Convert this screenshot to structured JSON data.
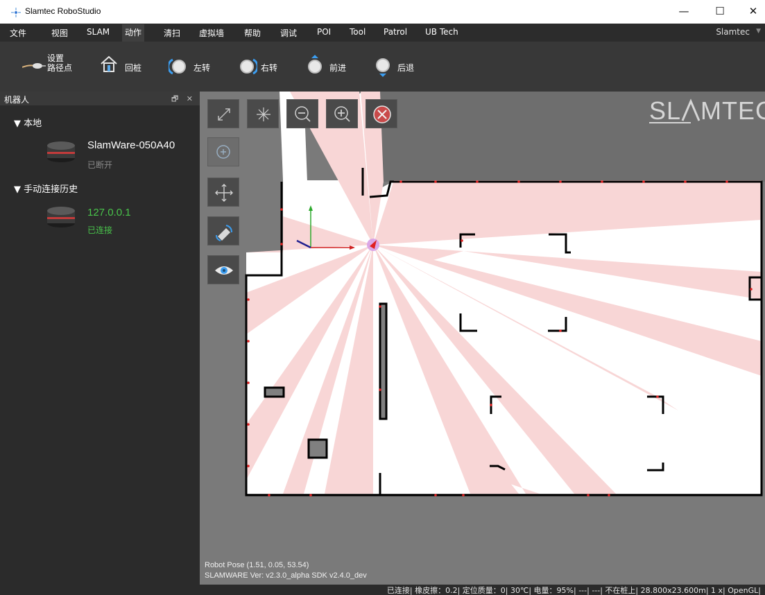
{
  "window": {
    "title": "Slamtec RoboStudio",
    "minimize": "—",
    "maximize": "☐",
    "close": "✕"
  },
  "menu": {
    "items": [
      "文件",
      "视图",
      "SLAM",
      "动作",
      "清扫",
      "虚拟墙",
      "帮助",
      "调试",
      "POI",
      "Tool",
      "Patrol",
      "UB Tech"
    ],
    "active": "动作",
    "user": "Slamtec"
  },
  "toolbar": {
    "set_path_line1": "设置",
    "set_path_line2": "路径点",
    "dock": "回桩",
    "turn_left": "左转",
    "turn_right": "右转",
    "forward": "前进",
    "backward": "后退"
  },
  "panel": {
    "title": "机器人",
    "buttons": "🗗 ✕",
    "local_section": "▼  本地",
    "history_section": "▼  手动连接历史",
    "robots": [
      {
        "name": "SlamWare-050A40",
        "status": "已断开",
        "status_color": "#8a8a8a",
        "name_color": "#ffffff"
      },
      {
        "name": "127.0.0.1",
        "status": "已连接",
        "status_color": "#49c44b",
        "name_color": "#49c44b"
      }
    ]
  },
  "map": {
    "logo": "SL⁄\\MTEC",
    "robot_pose": "Robot Pose (1.51, 0.05, 53.54)",
    "sdk": "SLAMWARE Ver: v2.3.0_alpha  SDK  v2.4.0_dev",
    "tools": [
      "expand-icon",
      "center-icon",
      "zoom-out-icon",
      "zoom-in-icon",
      "clear-icon",
      "zoom-fit-icon",
      "move-icon",
      "relocate-icon",
      "view-icon"
    ],
    "colors": {
      "background": "#7a7a7a",
      "free": "#ffffff",
      "scan": "#f8d6d6",
      "wall": "#000000",
      "laser_point": "#e02020"
    }
  },
  "status": {
    "text": "已连接| 橡皮擦：0.2| 定位质量：0| 30℃| 电量：95%| ---| ---| 不在桩上| 28.800x23.600m| 1 x| OpenGL|"
  }
}
